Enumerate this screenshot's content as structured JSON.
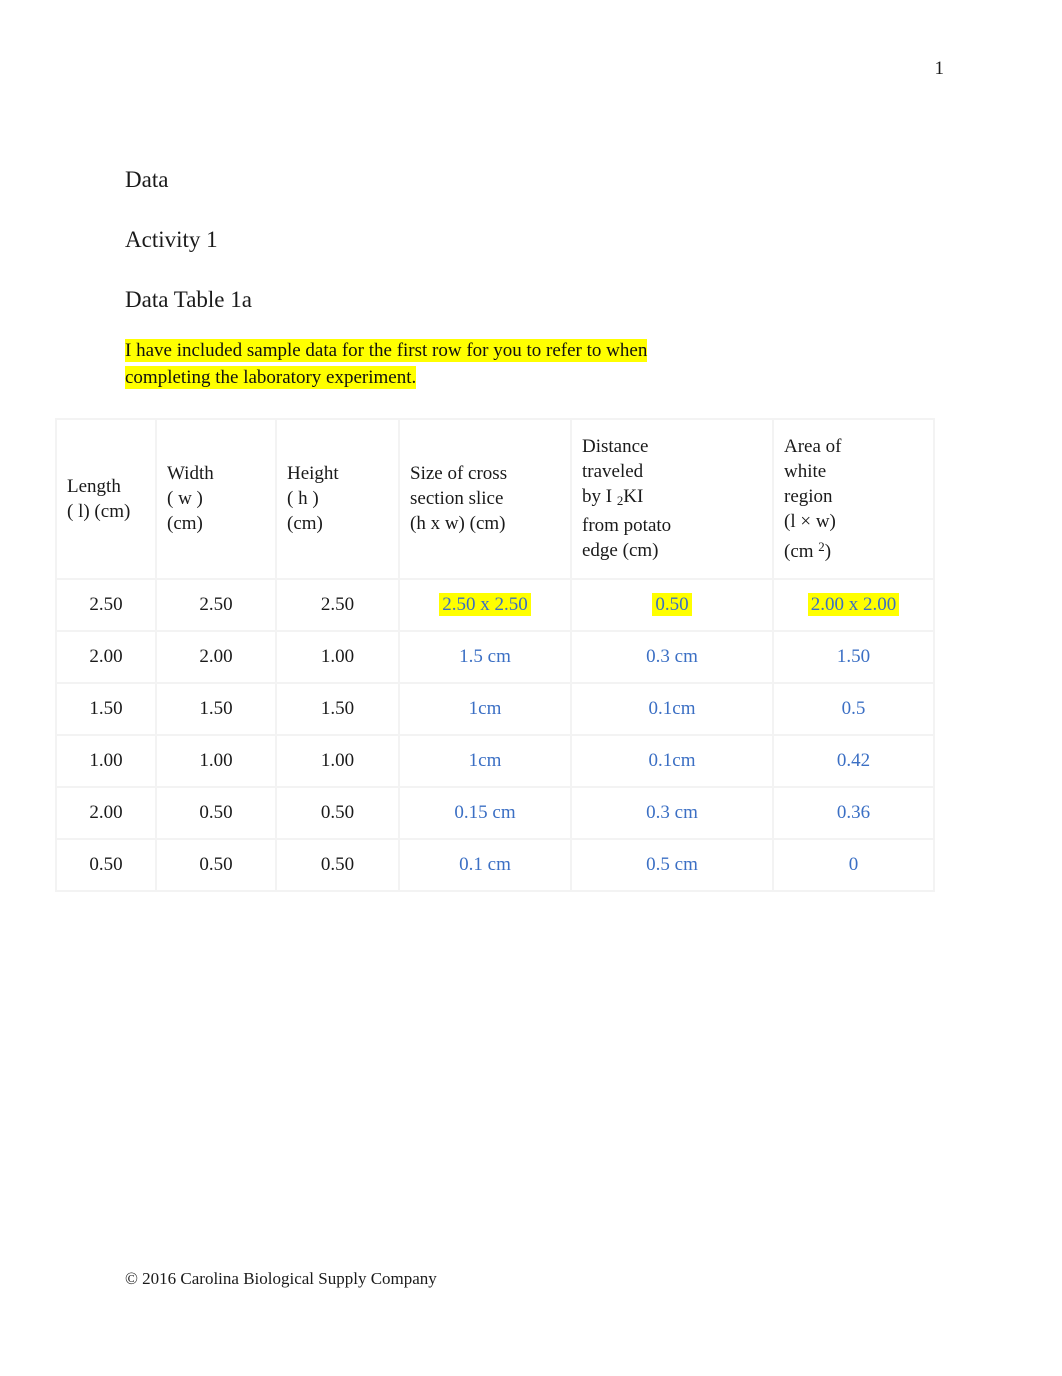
{
  "page": {
    "number": "1",
    "footer": "© 2016 Carolina Biological Supply Company"
  },
  "headings": {
    "data": "Data",
    "activity": "Activity 1",
    "table_title": "Data Table 1a"
  },
  "note": {
    "line1": "I have included sample data for the first row for you to refer to when",
    "line2": "completing the laboratory experiment."
  },
  "table": {
    "columns": [
      {
        "key": "length",
        "lines": [
          "Length",
          "( l) (cm)"
        ]
      },
      {
        "key": "width",
        "lines": [
          "Width",
          "( w )",
          "(cm)"
        ]
      },
      {
        "key": "height",
        "lines": [
          "Height",
          "( h )",
          "(cm)"
        ]
      },
      {
        "key": "cross_section",
        "lines": [
          "Size of cross",
          "section slice",
          "(h x w) (cm)"
        ]
      },
      {
        "key": "distance",
        "lines": [
          "Distance",
          "traveled",
          "by I ₂KI",
          "from potato",
          "edge (cm)"
        ]
      },
      {
        "key": "white_area",
        "lines": [
          "Area of",
          "white",
          "region",
          "(l × w)",
          "(cm ²)"
        ]
      }
    ],
    "rows": [
      {
        "length": "2.50",
        "width": "2.50",
        "height": "2.50",
        "cross_section": "2.50 x 2.50",
        "distance": "0.50",
        "white_area": "2.00 x 2.00",
        "highlighted": true
      },
      {
        "length": "2.00",
        "width": "2.00",
        "height": "1.00",
        "cross_section": "1.5 cm",
        "distance": "0.3 cm",
        "white_area": "1.50",
        "highlighted": false
      },
      {
        "length": "1.50",
        "width": "1.50",
        "height": "1.50",
        "cross_section": "1cm",
        "distance": "0.1cm",
        "white_area": "0.5",
        "highlighted": false
      },
      {
        "length": "1.00",
        "width": "1.00",
        "height": "1.00",
        "cross_section": "1cm",
        "distance": "0.1cm",
        "white_area": "0.42",
        "highlighted": false
      },
      {
        "length": "2.00",
        "width": "0.50",
        "height": "0.50",
        "cross_section": "0.15 cm",
        "distance": "0.3 cm",
        "white_area": "0.36",
        "highlighted": false
      },
      {
        "length": "0.50",
        "width": "0.50",
        "height": "0.50",
        "cross_section": "0.1 cm",
        "distance": "0.5 cm",
        "white_area": "0",
        "highlighted": false
      }
    ]
  },
  "colors": {
    "answer_text": "#3b6fc4",
    "highlight": "#ffff00",
    "gridline": "#f3f3f3"
  }
}
